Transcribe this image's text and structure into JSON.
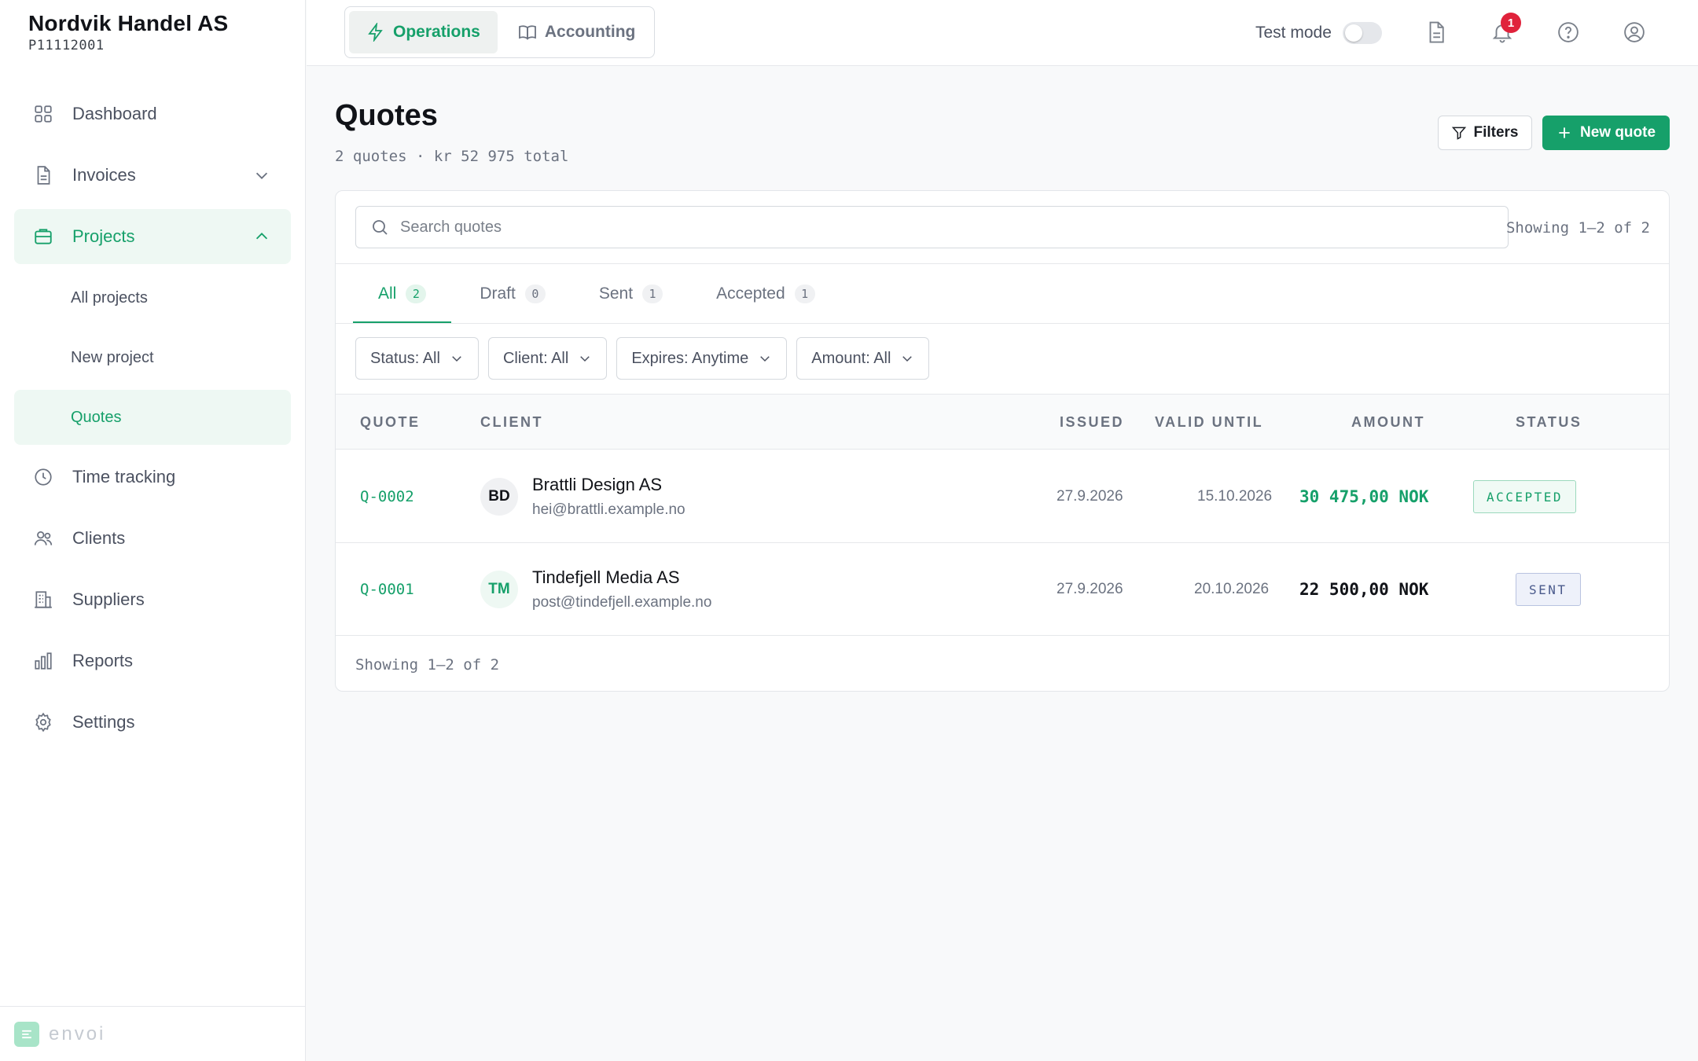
{
  "org": {
    "name": "Nordvik Handel AS",
    "id": "P11112001"
  },
  "nav": {
    "dashboard": "Dashboard",
    "invoices": "Invoices",
    "projects": "Projects",
    "projects_sub": {
      "all": "All projects",
      "new": "New project",
      "quotes": "Quotes"
    },
    "time_tracking": "Time tracking",
    "clients": "Clients",
    "suppliers": "Suppliers",
    "reports": "Reports",
    "settings": "Settings"
  },
  "brand": {
    "name": "envoi"
  },
  "topbar": {
    "modes": {
      "operations": "Operations",
      "accounting": "Accounting"
    },
    "test_mode_label": "Test mode",
    "test_mode_on": false,
    "notification_count": "1"
  },
  "page": {
    "title": "Quotes",
    "subtitle": "2 quotes · kr 52 975 total",
    "filters_button": "Filters",
    "new_button": "New quote"
  },
  "search": {
    "placeholder": "Search quotes",
    "value": ""
  },
  "showing": "Showing 1–2 of 2",
  "tabs": [
    {
      "label": "All",
      "count": "2"
    },
    {
      "label": "Draft",
      "count": "0"
    },
    {
      "label": "Sent",
      "count": "1"
    },
    {
      "label": "Accepted",
      "count": "1"
    }
  ],
  "filters": {
    "status": "Status: All",
    "client": "Client: All",
    "expires": "Expires: Anytime",
    "amount": "Amount: All"
  },
  "table": {
    "headers": {
      "quote": "QUOTE",
      "client": "CLIENT",
      "issued": "ISSUED",
      "valid_until": "VALID UNTIL",
      "amount": "AMOUNT",
      "status": "STATUS"
    },
    "rows": [
      {
        "id": "Q-0002",
        "initials": "BD",
        "client": "Brattli Design AS",
        "email": "hei@brattli.example.no",
        "issued": "27.9.2026",
        "valid_until": "15.10.2026",
        "amount": "30 475,00 NOK",
        "status": "ACCEPTED"
      },
      {
        "id": "Q-0001",
        "initials": "TM",
        "client": "Tindefjell Media AS",
        "email": "post@tindefjell.example.no",
        "issued": "27.9.2026",
        "valid_until": "20.10.2026",
        "amount": "22 500,00 NOK",
        "status": "SENT"
      }
    ]
  },
  "colors": {
    "accent": "#16a06a",
    "accent_bg": "#eef8f3",
    "badge": "#e0223b",
    "sent": "#4a5a8c"
  }
}
